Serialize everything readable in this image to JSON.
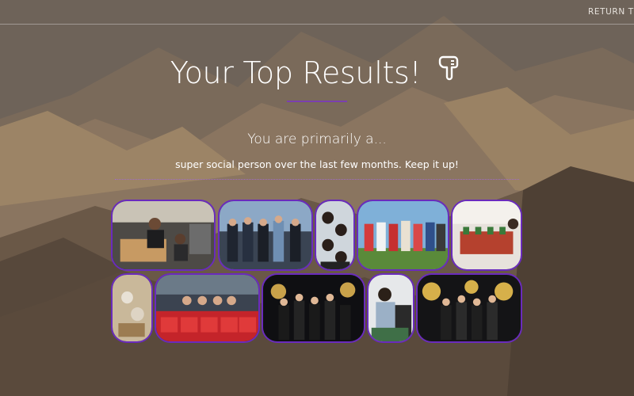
{
  "nav": {
    "return_label": "RETURN TO"
  },
  "results": {
    "title": "Your Top Results!",
    "hand_icon": "pointing-hand-down-icon",
    "primary_text": "You are primarily a...",
    "description": "super social person over the last few months. Keep it up!"
  },
  "colors": {
    "accent": "#6a2bbd",
    "underline": "#7b3fb0",
    "dotted": "#a06bc9",
    "background": "#6b5e52"
  }
}
